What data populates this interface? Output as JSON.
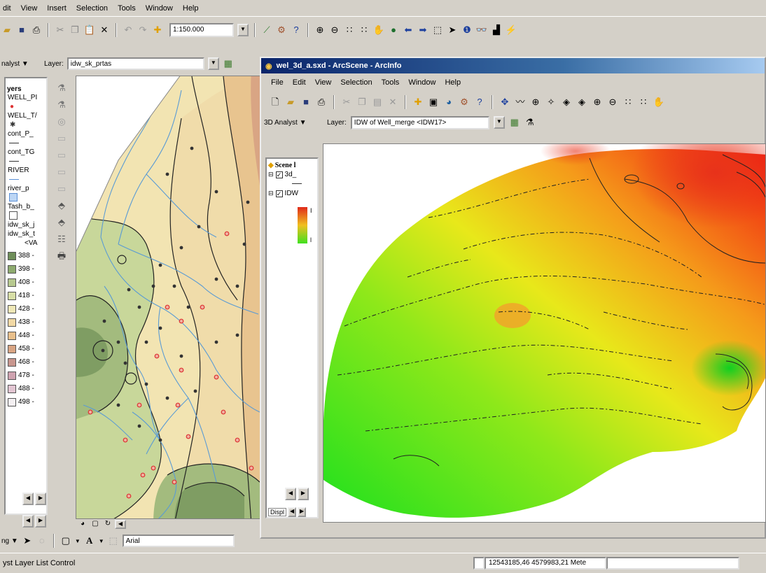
{
  "main": {
    "menus": [
      "dit",
      "View",
      "Insert",
      "Selection",
      "Tools",
      "Window",
      "Help"
    ],
    "scale": "1:150.000",
    "analyst_label": "nalyst ▼",
    "layer_label": "Layer:",
    "layer_value": "idw_sk_prtas"
  },
  "toc": {
    "header": "yers",
    "items": [
      "WELL_PI",
      "WELL_T/",
      "cont_P_",
      "cont_TG",
      "RIVER",
      "river_p",
      "Tash_b_",
      "idw_sk_j",
      "idw_sk_t",
      "<VA"
    ],
    "legend": [
      {
        "label": "388 -",
        "color": "#6f8e5a"
      },
      {
        "label": "398 -",
        "color": "#8eab6f"
      },
      {
        "label": "408 -",
        "color": "#b7c98f"
      },
      {
        "label": "418 -",
        "color": "#d8dfa7"
      },
      {
        "label": "428 -",
        "color": "#efe8b7"
      },
      {
        "label": "438 -",
        "color": "#f2d9a5"
      },
      {
        "label": "448 -",
        "color": "#e9c08c"
      },
      {
        "label": "458 -",
        "color": "#d9a584"
      },
      {
        "label": "468 -",
        "color": "#c8968e"
      },
      {
        "label": "478 -",
        "color": "#cfa3b0"
      },
      {
        "label": "488 -",
        "color": "#e3c6d3"
      },
      {
        "label": "498 -",
        "color": "#f4f0f2"
      }
    ]
  },
  "scene": {
    "title": "wel_3d_a.sxd - ArcScene - ArcInfo",
    "menus": [
      "File",
      "Edit",
      "View",
      "Selection",
      "Tools",
      "Window",
      "Help"
    ],
    "analyst_label": "3D Analyst ▼",
    "layer_label": "Layer:",
    "layer_value": "IDW of Well_merge <IDW17>",
    "toc_root": "Scene l",
    "toc_item1": "3d_",
    "toc_item2": "IDW",
    "toc_h": "I",
    "toc_l": "l",
    "display_tab": "Displ"
  },
  "drawing": {
    "font": "Arial"
  },
  "status": {
    "left": "yst Layer List Control",
    "coords": "12543185,46  4579983,21 Mete"
  }
}
